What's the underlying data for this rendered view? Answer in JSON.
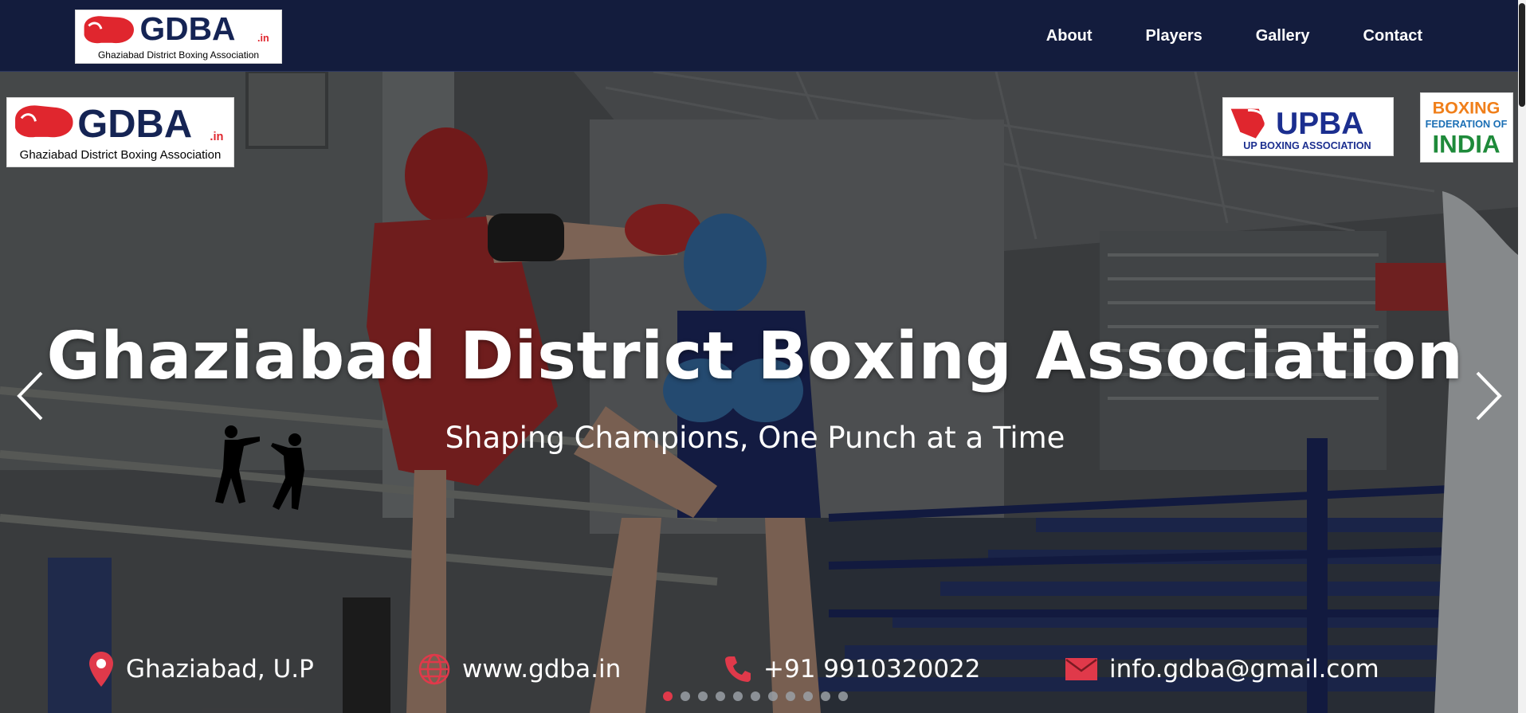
{
  "nav": {
    "logo": {
      "wordmark": "GDBA",
      "suffix": ".in",
      "caption": "Ghaziabad District Boxing Association"
    },
    "links": [
      {
        "label": "About"
      },
      {
        "label": "Players"
      },
      {
        "label": "Gallery"
      },
      {
        "label": "Contact"
      }
    ]
  },
  "hero": {
    "logo": {
      "wordmark": "GDBA",
      "suffix": ".in",
      "caption": "Ghaziabad District Boxing Association"
    },
    "partners": {
      "upba": {
        "wordmark": "UPBA",
        "caption": "UP BOXING ASSOCIATION"
      },
      "bfi": {
        "line1": "BOXING",
        "line2": "FEDERATION OF",
        "line3": "INDIA"
      }
    },
    "title": "Ghaziabad District Boxing Association",
    "subtitle": "Shaping Champions, One Punch at a Time",
    "contacts": {
      "location": {
        "text": "Ghaziabad, U.P",
        "icon": "map-pin-icon"
      },
      "website": {
        "text": "www.gdba.in",
        "icon": "globe-icon"
      },
      "phone": {
        "text": "+91 9910320022",
        "icon": "phone-icon"
      },
      "email": {
        "text": "info.gdba@gmail.com",
        "icon": "mail-icon"
      }
    },
    "carousel": {
      "total_slides": 11,
      "active_slide": 1
    }
  },
  "colors": {
    "navbar": "#131c3d",
    "accent_red": "#e0394a",
    "text": "#ffffff"
  }
}
